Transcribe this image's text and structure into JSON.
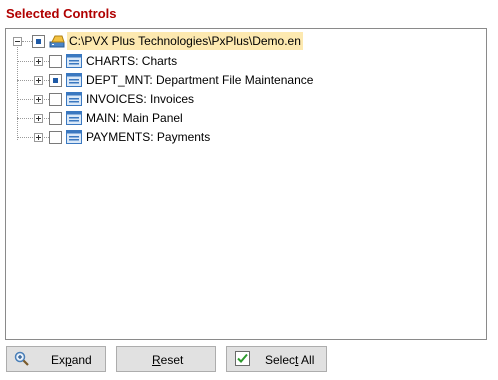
{
  "panel": {
    "title": "Selected Controls"
  },
  "tree": {
    "root": {
      "label": "C:\\PVX Plus Technologies\\PxPlus\\Demo.en",
      "state": "partial",
      "expanded": true
    },
    "children": [
      {
        "label": "CHARTS: Charts",
        "state": "unchecked"
      },
      {
        "label": "DEPT_MNT: Department File Maintenance",
        "state": "partial"
      },
      {
        "label": "INVOICES: Invoices",
        "state": "unchecked"
      },
      {
        "label": "MAIN: Main Panel",
        "state": "unchecked"
      },
      {
        "label": "PAYMENTS: Payments",
        "state": "unchecked"
      }
    ]
  },
  "buttons": {
    "expand": {
      "pre": "Ex",
      "hot": "p",
      "post": "and",
      "icon": "zoom-in-icon"
    },
    "reset": {
      "pre": "",
      "hot": "R",
      "post": "eset"
    },
    "select_all": {
      "pre": "Selec",
      "hot": "t",
      "post": " All",
      "icon": "checkmark-icon"
    }
  },
  "colors": {
    "title": "#b00000",
    "selection": "#fde9b0",
    "partial_fill": "#1f5aa6"
  }
}
